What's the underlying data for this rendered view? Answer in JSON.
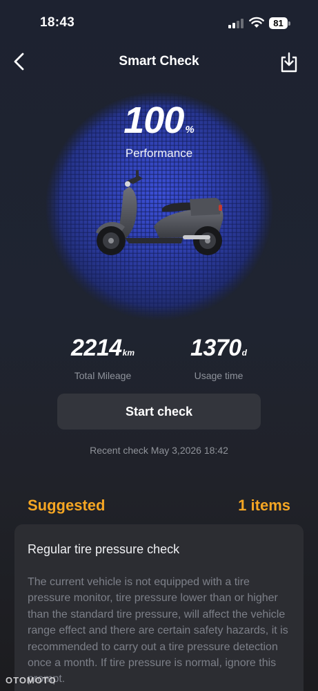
{
  "status_bar": {
    "time": "18:43",
    "battery": "81",
    "icons": [
      "cellular-signal-icon",
      "wifi-icon",
      "battery-icon"
    ]
  },
  "nav": {
    "title": "Smart Check",
    "back_icon": "chevron-left-icon",
    "export_icon": "download-tray-icon"
  },
  "performance": {
    "score": "100",
    "unit": "%",
    "label": "Performance"
  },
  "stats": {
    "mileage": {
      "value": "2214",
      "unit": "km",
      "label": "Total Mileage"
    },
    "usage": {
      "value": "1370",
      "unit": "d",
      "label": "Usage time"
    }
  },
  "start_check": {
    "label": "Start check"
  },
  "recent_check": "Recent check May 3,2026 18:42",
  "suggested": {
    "title": "Suggested",
    "count": "1 items",
    "items": [
      {
        "title": "Regular tire pressure check",
        "description": "The current vehicle is not equipped with a tire pressure monitor, tire pressure lower than or higher than the standard tire pressure, will affect the vehicle range effect and there are certain safety hazards, it is recommended to carry out a tire pressure detection once a month. If tire pressure is normal, ignore this prompt."
      }
    ]
  },
  "watermark": "OTOMOTO",
  "colors": {
    "accent": "#f5a623",
    "background": "#1f2431",
    "button": "#33353c",
    "card": "#2c2d32",
    "hero_blue": "#3b4fd6"
  }
}
